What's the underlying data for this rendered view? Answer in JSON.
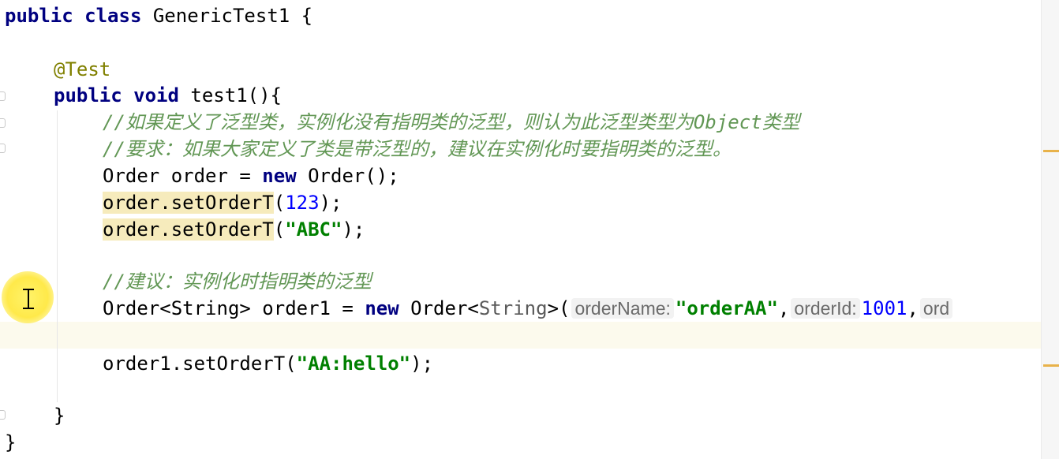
{
  "editor": {
    "lines": {
      "class_kw": "public class",
      "class_name": " GenericTest1 {",
      "annotation": "@Test",
      "method_kw": "public void",
      "method_sig": " test1(){",
      "comment1": "//如果定义了泛型类，实例化没有指明类的泛型，则认为此泛型类型为Object类型",
      "comment2": "//要求：如果大家定义了类是带泛型的，建议在实例化时要指明类的泛型。",
      "order_decl_a": "Order order = ",
      "order_decl_new": "new",
      "order_decl_b": " Order();",
      "set1_call": "order.setOrderT",
      "set1_open": "(",
      "set1_num": "123",
      "set1_close": ");",
      "set2_call": "order.setOrderT",
      "set2_open": "(",
      "set2_str": "\"ABC\"",
      "set2_close": ");",
      "comment3": "//建议：实例化时指明类的泛型",
      "generic_a": "Order<String> order1 = ",
      "generic_new": "new",
      "generic_b": " Order<",
      "generic_type": "String",
      "generic_c": ">(",
      "hint_order_name": "orderName:",
      "generic_str": "\"orderAA\"",
      "comma1": ",",
      "hint_order_id": "orderId:",
      "generic_num": "1001",
      "comma2": ",",
      "hint_trunc": "ord",
      "set3_a": "order1.setOrderT(",
      "set3_str": "\"AA:hello\"",
      "set3_b": ");",
      "method_close": "}",
      "class_close": "}"
    }
  },
  "colors": {
    "keyword": "#000080",
    "comment": "#629755",
    "string": "#008000",
    "number": "#0000ff",
    "annotation": "#808000",
    "highlight": "#f6ebbc",
    "caret_line": "#fcfaed"
  }
}
